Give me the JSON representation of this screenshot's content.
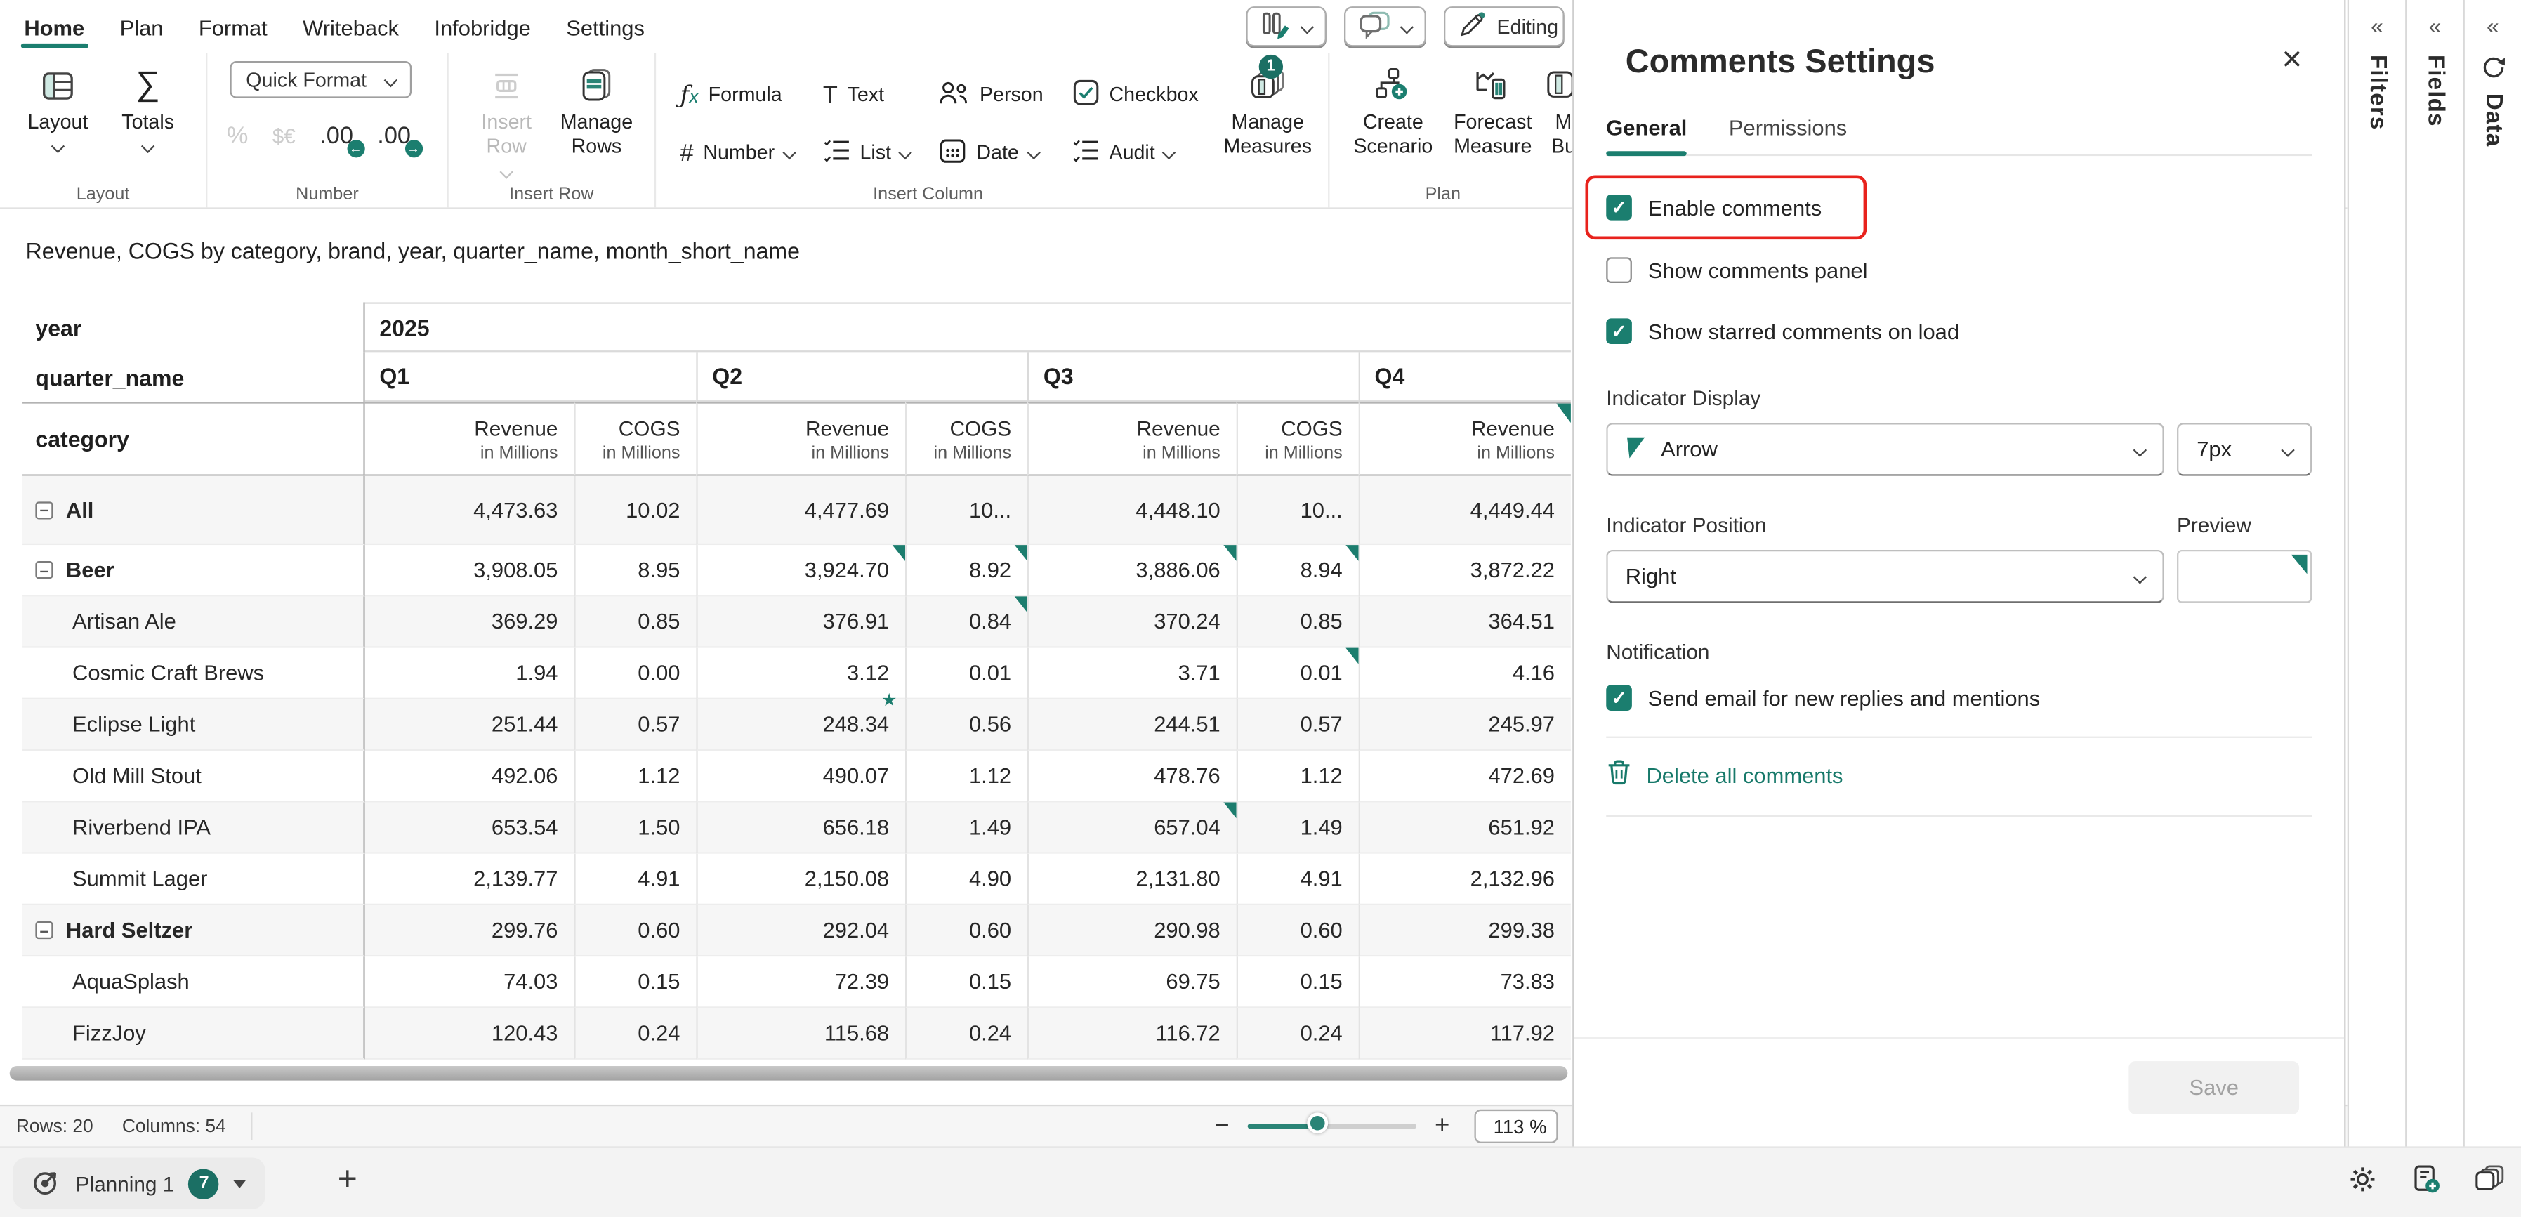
{
  "colors": {
    "accent": "#1b7e6f",
    "accent_dark": "#1b6f64",
    "red_highlight": "#e8221c",
    "disabled_text": "#a2a2a2"
  },
  "menu_bar": {
    "tabs": [
      {
        "id": "home",
        "label": "Home",
        "active": true
      },
      {
        "id": "plan",
        "label": "Plan",
        "active": false
      },
      {
        "id": "format",
        "label": "Format",
        "active": false
      },
      {
        "id": "writeback",
        "label": "Writeback",
        "active": false
      },
      {
        "id": "infobridge",
        "label": "Infobridge",
        "active": false
      },
      {
        "id": "settings",
        "label": "Settings",
        "active": false
      }
    ]
  },
  "toolbar": {
    "layout_group": {
      "label": "Layout",
      "layout_button": "Layout",
      "totals_button": "Totals"
    },
    "number_group": {
      "label": "Number",
      "quick_format": "Quick Format"
    },
    "insert_row_group": {
      "label": "Insert Row",
      "insert_row_button": "Insert Row",
      "manage_rows_button": "Manage Rows"
    },
    "insert_column_group": {
      "label": "Insert Column",
      "formula": "Formula",
      "number": "Number",
      "text": "Text",
      "list": "List",
      "person": "Person",
      "date": "Date",
      "checkbox": "Checkbox",
      "audit": "Audit",
      "manage_measures": "Manage Measures",
      "manage_measures_badge": "1"
    },
    "plan_group": {
      "label": "Plan",
      "create_scenario": "Create Scenario",
      "forecast_measure": "Forecast Measure",
      "clipped_button_line1": "M",
      "clipped_button_line2": "Bu"
    },
    "editing_button": "Editing"
  },
  "report": {
    "title": "Revenue, COGS by category, brand, year, quarter_name, month_short_name",
    "matrix": {
      "row_header_labels": {
        "year": "year",
        "quarter": "quarter_name",
        "category": "category"
      },
      "year_value": "2025",
      "quarters": [
        "Q1",
        "Q2",
        "Q3",
        "Q4"
      ],
      "columns": [
        {
          "measure": "Revenue",
          "unit": "in Millions"
        },
        {
          "measure": "COGS",
          "unit": "in Millions"
        },
        {
          "measure": "Revenue",
          "unit": "in Millions"
        },
        {
          "measure": "COGS",
          "unit": "in Millions"
        },
        {
          "measure": "Revenue",
          "unit": "in Millions"
        },
        {
          "measure": "COGS",
          "unit": "in Millions"
        },
        {
          "measure": "Revenue",
          "unit": "in Millions"
        }
      ],
      "header_marker_col": 6,
      "rows": [
        {
          "label": "All",
          "level": 0,
          "collapse": true,
          "values": [
            "4,473.63",
            "10.02",
            "4,477.69",
            "10...",
            "4,448.10",
            "10...",
            "4,449.44"
          ],
          "markers": []
        },
        {
          "label": "Beer",
          "level": 1,
          "collapse": true,
          "values": [
            "3,908.05",
            "8.95",
            "3,924.70",
            "8.92",
            "3,886.06",
            "8.94",
            "3,872.22"
          ],
          "markers": [
            {
              "col": 2,
              "type": "triangle"
            },
            {
              "col": 3,
              "type": "triangle"
            },
            {
              "col": 4,
              "type": "triangle"
            },
            {
              "col": 5,
              "type": "triangle"
            }
          ]
        },
        {
          "label": "Artisan Ale",
          "level": 2,
          "collapse": false,
          "values": [
            "369.29",
            "0.85",
            "376.91",
            "0.84",
            "370.24",
            "0.85",
            "364.51"
          ],
          "markers": [
            {
              "col": 3,
              "type": "triangle"
            }
          ]
        },
        {
          "label": "Cosmic Craft Brews",
          "level": 2,
          "collapse": false,
          "values": [
            "1.94",
            "0.00",
            "3.12",
            "0.01",
            "3.71",
            "0.01",
            "4.16"
          ],
          "markers": [
            {
              "col": 5,
              "type": "triangle"
            }
          ]
        },
        {
          "label": "Eclipse Light",
          "level": 2,
          "collapse": false,
          "values": [
            "251.44",
            "0.57",
            "248.34",
            "0.56",
            "244.51",
            "0.57",
            "245.97"
          ],
          "markers": [
            {
              "col": 2,
              "type": "star"
            }
          ]
        },
        {
          "label": "Old Mill Stout",
          "level": 2,
          "collapse": false,
          "values": [
            "492.06",
            "1.12",
            "490.07",
            "1.12",
            "478.76",
            "1.12",
            "472.69"
          ],
          "markers": []
        },
        {
          "label": "Riverbend IPA",
          "level": 2,
          "collapse": false,
          "values": [
            "653.54",
            "1.50",
            "656.18",
            "1.49",
            "657.04",
            "1.49",
            "651.92"
          ],
          "markers": [
            {
              "col": 4,
              "type": "triangle"
            }
          ]
        },
        {
          "label": "Summit Lager",
          "level": 2,
          "collapse": false,
          "values": [
            "2,139.77",
            "4.91",
            "2,150.08",
            "4.90",
            "2,131.80",
            "4.91",
            "2,132.96"
          ],
          "markers": []
        },
        {
          "label": "Hard Seltzer",
          "level": 1,
          "collapse": true,
          "values": [
            "299.76",
            "0.60",
            "292.04",
            "0.60",
            "290.98",
            "0.60",
            "299.38"
          ],
          "markers": []
        },
        {
          "label": "AquaSplash",
          "level": 2,
          "collapse": false,
          "values": [
            "74.03",
            "0.15",
            "72.39",
            "0.15",
            "69.75",
            "0.15",
            "73.83"
          ],
          "markers": []
        },
        {
          "label": "FizzJoy",
          "level": 2,
          "collapse": false,
          "values": [
            "120.43",
            "0.24",
            "115.68",
            "0.24",
            "116.72",
            "0.24",
            "117.92"
          ],
          "markers": []
        }
      ]
    }
  },
  "comments_panel": {
    "title": "Comments Settings",
    "tabs": [
      {
        "label": "General",
        "active": true
      },
      {
        "label": "Permissions",
        "active": false
      }
    ],
    "checkboxes": {
      "enable_comments": {
        "label": "Enable comments",
        "checked": true,
        "highlighted": true
      },
      "show_comments_panel": {
        "label": "Show comments panel",
        "checked": false
      },
      "show_starred": {
        "label": "Show starred comments on load",
        "checked": true
      }
    },
    "indicator_display": {
      "label": "Indicator Display",
      "value": "Arrow",
      "size_value": "7px"
    },
    "indicator_position": {
      "label": "Indicator Position",
      "value": "Right",
      "preview_label": "Preview"
    },
    "notification": {
      "label": "Notification",
      "send_email": {
        "label": "Send email for new replies and mentions",
        "checked": true
      }
    },
    "delete_all_label": "Delete all comments",
    "save_button": "Save"
  },
  "right_rail": {
    "panels": [
      "Filters",
      "Fields",
      "Data"
    ]
  },
  "status_bar": {
    "rows_label": "Rows: 20",
    "columns_label": "Columns: 54",
    "zoom_value": "113 %"
  },
  "bottom_bar": {
    "sheet_tab": "Planning 1",
    "sheet_badge": "7"
  }
}
